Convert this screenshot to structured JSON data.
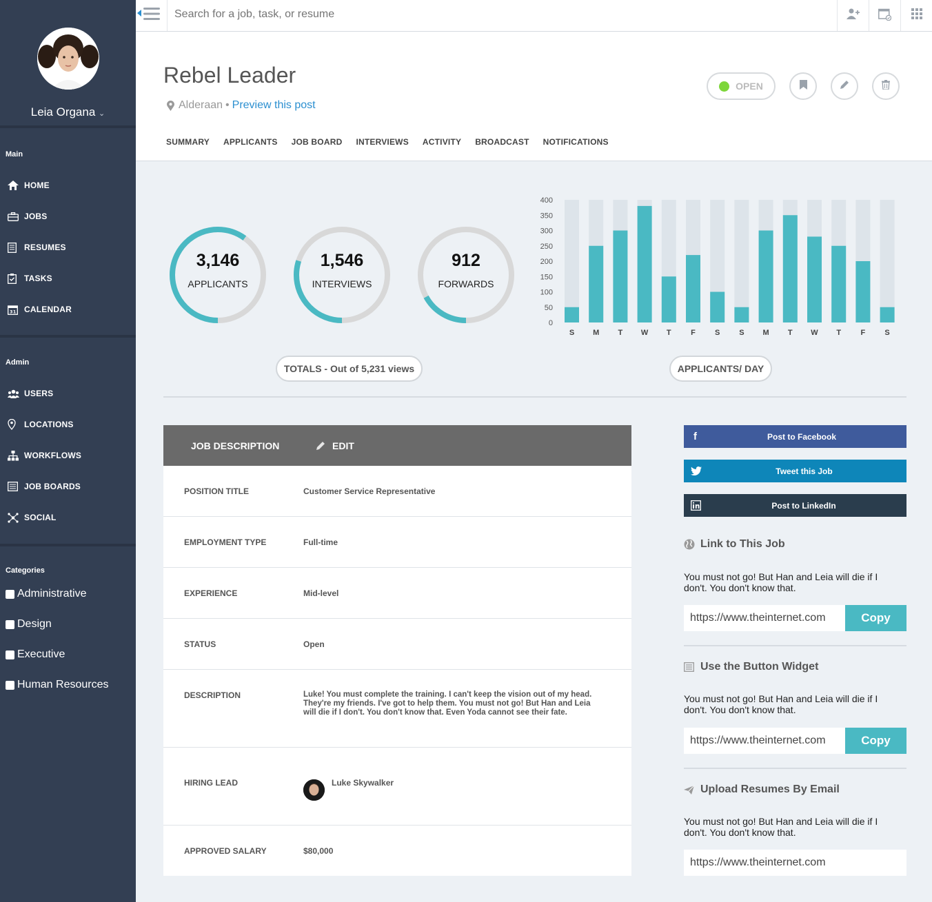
{
  "user": {
    "name": "Leia Organa"
  },
  "nav": {
    "main_label": "Main",
    "main": [
      "HOME",
      "JOBS",
      "RESUMES",
      "TASKS",
      "CALENDAR"
    ],
    "admin_label": "Admin",
    "admin": [
      "USERS",
      "LOCATIONS",
      "WORKFLOWS",
      "JOB BOARDS",
      "SOCIAL"
    ],
    "categories_label": "Categories",
    "categories": [
      "Administrative",
      "Design",
      "Executive",
      "Human Resources"
    ]
  },
  "search": {
    "placeholder": "Search for a job, task, or resume"
  },
  "job": {
    "title": "Rebel Leader",
    "location": "Alderaan",
    "bullet": "•",
    "preview_link": "Preview this post",
    "status": "OPEN",
    "status_color": "#7dd63a"
  },
  "tabs": [
    "SUMMARY",
    "APPLICANTS",
    "JOB BOARD",
    "INTERVIEWS",
    "ACTIVITY",
    "BROADCAST",
    "NOTIFICATIONS"
  ],
  "stats": {
    "applicants": {
      "value": "3,146",
      "label": "APPLICANTS",
      "fraction": 0.6
    },
    "interviews": {
      "value": "1,546",
      "label": "INTERVIEWS",
      "fraction": 0.3
    },
    "forwards": {
      "value": "912",
      "label": "FORWARDS",
      "fraction": 0.17
    },
    "totals_label": "TOTALS - Out of 5,231 views",
    "chart_label": "APPLICANTS/ DAY"
  },
  "colors": {
    "accent": "#4ab9c3",
    "track": "#d8d8d8",
    "bar_bg": "#dde4ea",
    "sidebar": "#333f53"
  },
  "chart_data": {
    "type": "bar",
    "categories": [
      "S",
      "M",
      "T",
      "W",
      "T",
      "F",
      "S",
      "S",
      "M",
      "T",
      "W",
      "T",
      "F",
      "S"
    ],
    "values": [
      50,
      250,
      300,
      380,
      150,
      220,
      100,
      50,
      300,
      350,
      280,
      250,
      200,
      50
    ],
    "ylim": [
      0,
      400
    ],
    "yticks": [
      "0",
      "50",
      "100",
      "150",
      "200",
      "250",
      "300",
      "350",
      "400"
    ]
  },
  "job_description": {
    "header": "JOB DESCRIPTION",
    "edit": "EDIT",
    "rows": [
      {
        "key": "POSITION TITLE",
        "value": "Customer Service Representative"
      },
      {
        "key": "EMPLOYMENT TYPE",
        "value": "Full-time"
      },
      {
        "key": "EXPERIENCE",
        "value": "Mid-level"
      },
      {
        "key": "STATUS",
        "value": "Open"
      },
      {
        "key": "DESCRIPTION",
        "value": "Luke! You must complete the training. I can't keep the vision out of my head. They're my friends. I've got to help them. You must not go! But Han and Leia will die if I don't. You don't know that. Even Yoda cannot see their fate."
      },
      {
        "key": "HIRING LEAD",
        "value": "Luke Skywalker"
      },
      {
        "key": "APPROVED SALARY",
        "value": "$80,000"
      }
    ]
  },
  "share": {
    "facebook": "Post to Facebook",
    "twitter": "Tweet this Job",
    "linkedin": "Post to LinkedIn",
    "link_title": "Link to This Job",
    "link_text": "You must not go! But Han and Leia will die if I don't. You don't know that.",
    "link_url": "https://www.theinternet.com",
    "copy": "Copy",
    "widget_title": "Use the Button Widget",
    "widget_text": "You must not go! But Han and Leia will die if I don't. You don't know that.",
    "widget_url": "https://www.theinternet.com",
    "email_title": "Upload Resumes By Email",
    "email_text": "You must not go! But Han and Leia will die if I don't. You don't know that.",
    "email_url": "https://www.theinternet.com"
  }
}
